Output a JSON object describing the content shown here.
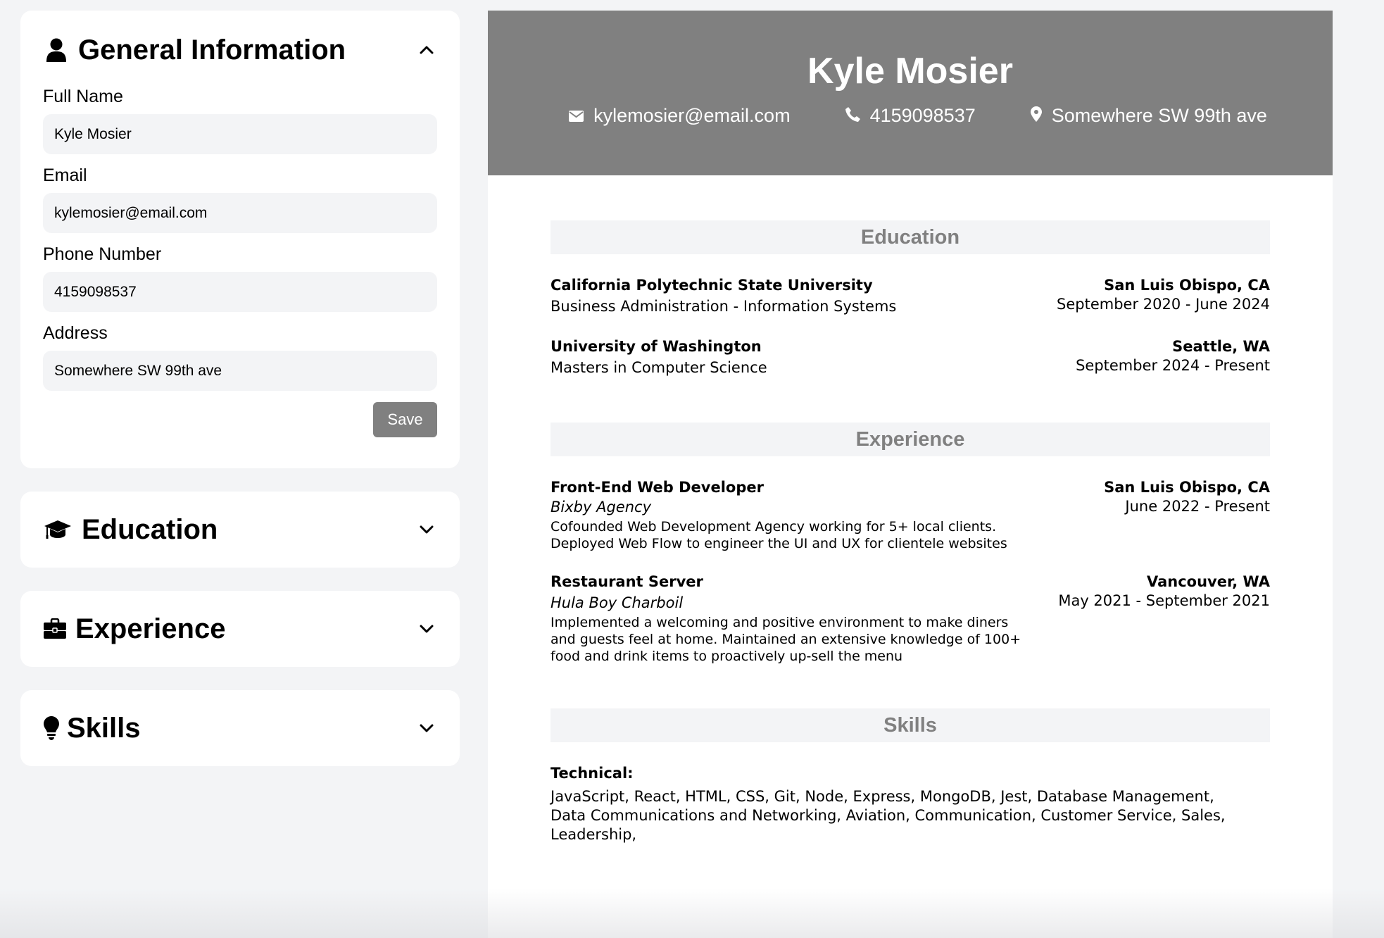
{
  "editor": {
    "general": {
      "title": "General Information",
      "fields": [
        {
          "label": "Full Name",
          "value": "Kyle Mosier"
        },
        {
          "label": "Email",
          "value": "kylemosier@email.com"
        },
        {
          "label": "Phone Number",
          "value": "4159098537"
        },
        {
          "label": "Address",
          "value": "Somewhere SW 99th ave"
        }
      ],
      "save_label": "Save"
    },
    "education": {
      "title": "Education"
    },
    "experience": {
      "title": "Experience"
    },
    "skills": {
      "title": "Skills"
    }
  },
  "resume": {
    "name": "Kyle Mosier",
    "email": "kylemosier@email.com",
    "phone": "4159098537",
    "address": "Somewhere SW 99th ave",
    "education_title": "Education",
    "education": [
      {
        "school": "California Polytechnic State University",
        "degree": "Business Administration - Information Systems",
        "location": "San Luis Obispo, CA",
        "dates": "September 2020 - June 2024"
      },
      {
        "school": "University of Washington",
        "degree": "Masters in Computer Science",
        "location": "Seattle, WA",
        "dates": "September 2024 - Present"
      }
    ],
    "experience_title": "Experience",
    "experience": [
      {
        "position": "Front-End Web Developer",
        "company": "Bixby Agency",
        "location": "San Luis Obispo, CA",
        "dates": "June 2022 - Present",
        "description": "Cofounded Web Development Agency working for 5+ local clients. Deployed Web Flow to engineer the UI and UX for clientele websites"
      },
      {
        "position": "Restaurant Server",
        "company": "Hula Boy Charboil",
        "location": "Vancouver, WA",
        "dates": "May 2021 - September 2021",
        "description": "Implemented a welcoming and positive environment to make diners and guests feel at home. Maintained an extensive knowledge of 100+ food and drink items to proactively up-sell the menu"
      }
    ],
    "skills_title": "Skills",
    "skills": {
      "category": "Technical:",
      "list": "JavaScript, React, HTML, CSS, Git, Node, Express, MongoDB, Jest, Database Management, Data Communications and Networking, Aviation, Communication, Customer Service, Sales, Leadership,"
    }
  }
}
